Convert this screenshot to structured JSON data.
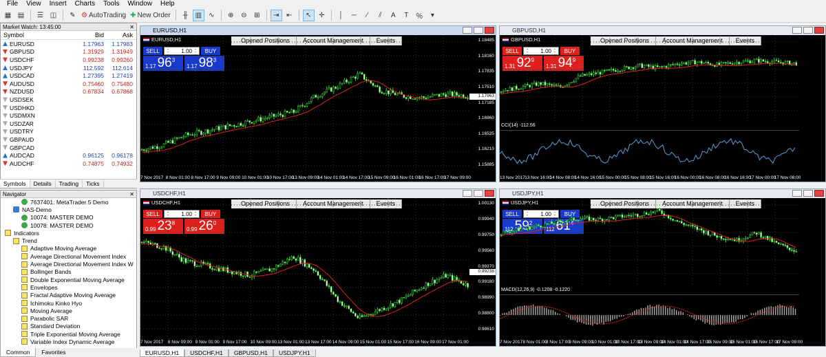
{
  "menu": [
    "File",
    "View",
    "Insert",
    "Charts",
    "Tools",
    "Window",
    "Help"
  ],
  "toolbar": {
    "autotrading": "AutoTrading",
    "neworder": "New Order"
  },
  "market_watch": {
    "title": "Market Watch: 13:45:00",
    "headers": [
      "Symbol",
      "Bid",
      "Ask"
    ],
    "rows": [
      {
        "sym": "EURUSD",
        "bid": "1.17963",
        "ask": "1.17983",
        "dir": "up",
        "color": "blue"
      },
      {
        "sym": "GBPUSD",
        "bid": "1.31929",
        "ask": "1.31949",
        "dir": "dn",
        "color": "red"
      },
      {
        "sym": "USDCHF",
        "bid": "0.99238",
        "ask": "0.99260",
        "dir": "dn",
        "color": "red"
      },
      {
        "sym": "USDJPY",
        "bid": "112.592",
        "ask": "112.614",
        "dir": "up",
        "color": "blue"
      },
      {
        "sym": "USDCAD",
        "bid": "1.27395",
        "ask": "1.27419",
        "dir": "up",
        "color": "blue"
      },
      {
        "sym": "AUDUSD",
        "bid": "0.75460",
        "ask": "0.75480",
        "dir": "dn",
        "color": "red"
      },
      {
        "sym": "NZDUSD",
        "bid": "0.67834",
        "ask": "0.67868",
        "dir": "dn",
        "color": "red"
      },
      {
        "sym": "USDSEK",
        "bid": "",
        "ask": "",
        "dir": "nn",
        "color": "blue"
      },
      {
        "sym": "USDHKD",
        "bid": "",
        "ask": "",
        "dir": "nn",
        "color": "blue"
      },
      {
        "sym": "USDMXN",
        "bid": "",
        "ask": "",
        "dir": "nn",
        "color": "blue"
      },
      {
        "sym": "USDZAR",
        "bid": "",
        "ask": "",
        "dir": "nn",
        "color": "blue"
      },
      {
        "sym": "USDTRY",
        "bid": "",
        "ask": "",
        "dir": "nn",
        "color": "blue"
      },
      {
        "sym": "GBPAUD",
        "bid": "",
        "ask": "",
        "dir": "nn",
        "color": "blue"
      },
      {
        "sym": "GBPCAD",
        "bid": "",
        "ask": "",
        "dir": "nn",
        "color": "blue"
      },
      {
        "sym": "AUDCAD",
        "bid": "0.96125",
        "ask": "0.96178",
        "dir": "up",
        "color": "blue"
      },
      {
        "sym": "AUDCHF",
        "bid": "0.74875",
        "ask": "0.74932",
        "dir": "dn",
        "color": "red"
      }
    ],
    "tabs": [
      "Symbols",
      "Details",
      "Trading",
      "Ticks"
    ]
  },
  "navigator": {
    "title": "Navigator",
    "items": [
      {
        "label": "7637401: MetaTrader 5 Demo",
        "indent": 2,
        "icon": "acc"
      },
      {
        "label": "NAS-Demo",
        "indent": 1,
        "icon": "mt5"
      },
      {
        "label": "10074: MASTER DEMO",
        "indent": 2,
        "icon": "acc"
      },
      {
        "label": "10078: MASTER DEMO",
        "indent": 2,
        "icon": "acc"
      },
      {
        "label": "Indicators",
        "indent": 0,
        "icon": "fold"
      },
      {
        "label": "Trend",
        "indent": 1,
        "icon": "fold"
      },
      {
        "label": "Adaptive Moving Average",
        "indent": 2,
        "icon": "ind"
      },
      {
        "label": "Average Directional Movement Index",
        "indent": 2,
        "icon": "ind"
      },
      {
        "label": "Average Directional Movement Index W",
        "indent": 2,
        "icon": "ind"
      },
      {
        "label": "Bollinger Bands",
        "indent": 2,
        "icon": "ind"
      },
      {
        "label": "Double Exponential Moving Average",
        "indent": 2,
        "icon": "ind"
      },
      {
        "label": "Envelopes",
        "indent": 2,
        "icon": "ind"
      },
      {
        "label": "Fractal Adaptive Moving Average",
        "indent": 2,
        "icon": "ind"
      },
      {
        "label": "Ichimoku Kinko Hyo",
        "indent": 2,
        "icon": "ind"
      },
      {
        "label": "Moving Average",
        "indent": 2,
        "icon": "ind"
      },
      {
        "label": "Parabolic SAR",
        "indent": 2,
        "icon": "ind"
      },
      {
        "label": "Standard Deviation",
        "indent": 2,
        "icon": "ind"
      },
      {
        "label": "Triple Exponential Moving Average",
        "indent": 2,
        "icon": "ind"
      },
      {
        "label": "Variable Index Dynamic Average",
        "indent": 2,
        "icon": "ind"
      }
    ],
    "tabs": [
      "Common",
      "Favorites"
    ]
  },
  "chart_tabs": [
    "Opened Positions",
    "Account Management",
    "Events"
  ],
  "one_click": {
    "sell": "SELL",
    "buy": "BUY",
    "lot": "1.00"
  },
  "charts": [
    {
      "title": "EURUSD,H1",
      "sym": "EURUSD,H1",
      "active": true,
      "sell": {
        "sm": "1.17",
        "lg": "96",
        "sup": "3"
      },
      "buy": {
        "sm": "1.17",
        "lg": "98",
        "sup": "3"
      },
      "box": "blue",
      "yticks": [
        "1.18485",
        "1.18160",
        "1.17835",
        "1.17510",
        "1.17185",
        "1.16860",
        "1.16535",
        "1.16210",
        "1.15885"
      ],
      "cur": "1.17963",
      "xticks": [
        "7 Nov 2017",
        "8 Nov 01:00",
        "8 Nov 17:00",
        "9 Nov 09:00",
        "10 Nov 01:00",
        "10 Nov 17:00",
        "13 Nov 09:00",
        "14 Nov 01:00",
        "14 Nov 17:00",
        "15 Nov 09:00",
        "16 Nov 01:00",
        "16 Nov 17:00",
        "17 Nov 09:00"
      ]
    },
    {
      "title": "GBPUSD,H1",
      "sym": "GBPUSD,H1",
      "active": false,
      "sell": {
        "sm": "1.31",
        "lg": "92",
        "sup": "9"
      },
      "buy": {
        "sm": "1.31",
        "lg": "94",
        "sup": "9"
      },
      "box": "red",
      "yticks": [],
      "cur": "",
      "indicator": "CCI(14) -112.56",
      "xticks": [
        "13 Nov 2017",
        "13 Nov 16:00",
        "14 Nov 08:00",
        "14 Nov 16:00",
        "15 Nov 00:00",
        "15 Nov 08:00",
        "15 Nov 16:00",
        "16 Nov 00:00",
        "16 Nov 08:00",
        "16 Nov 16:00",
        "17 Nov 00:00",
        "17 Nov 08:00"
      ]
    },
    {
      "title": "USDCHF,H1",
      "sym": "USDCHF,H1",
      "active": false,
      "sell": {
        "sm": "0.99",
        "lg": "23",
        "sup": "8"
      },
      "buy": {
        "sm": "0.99",
        "lg": "26",
        "sup": "0"
      },
      "box": "red",
      "yticks": [
        "1.00130",
        "0.99940",
        "0.99750",
        "0.99560",
        "0.99370",
        "0.99180",
        "0.98990",
        "0.98800",
        "0.98610"
      ],
      "cur": "0.99238",
      "xticks": [
        "7 Nov 2017",
        "8 Nov 09:00",
        "9 Nov 01:00",
        "9 Nov 17:00",
        "10 Nov 09:00",
        "13 Nov 01:00",
        "13 Nov 17:00",
        "14 Nov 09:00",
        "15 Nov 01:00",
        "15 Nov 17:00",
        "16 Nov 09:00",
        "17 Nov 01:00"
      ]
    },
    {
      "title": "USDJPY,H1",
      "sym": "USDJPY,H1",
      "active": false,
      "sell": {
        "sm": "112",
        "lg": "59",
        "sup": "2"
      },
      "buy": {
        "sm": "112",
        "lg": "61",
        "sup": "4"
      },
      "box": "blue",
      "yticks": [],
      "cur": "",
      "indicator": "MACD(12,26,9) -0.1208 -0.1220",
      "xticks": [
        "7 Nov 2017",
        "8 Nov 01:00",
        "8 Nov 17:00",
        "9 Nov 09:00",
        "10 Nov 01:00",
        "10 Nov 17:00",
        "13 Nov 09:00",
        "14 Nov 01:00",
        "14 Nov 17:00",
        "15 Nov 09:00",
        "16 Nov 01:00",
        "16 Nov 17:00",
        "17 Nov 09:00"
      ]
    }
  ],
  "bottom_tabs": [
    "EURUSD,H1",
    "USDCHF,H1",
    "GBPUSD,H1",
    "USDJPY,H1"
  ]
}
